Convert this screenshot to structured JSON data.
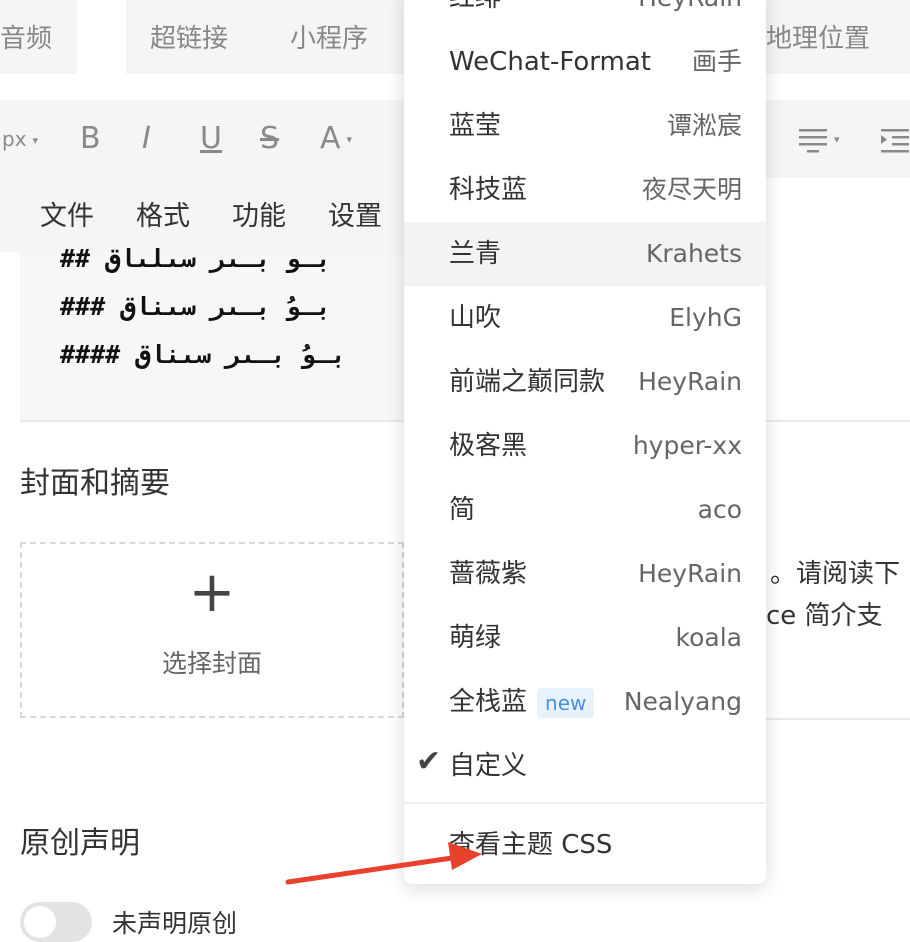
{
  "tabs": {
    "audio": "音频",
    "hyperlink": "超链接",
    "mini_program": "小程序",
    "location": "地理位置"
  },
  "toolbar": {
    "font_size_unit": "px",
    "bold": "B",
    "italic": "I",
    "underline": "U",
    "strikethrough": "S",
    "font_color": "A"
  },
  "menubar": {
    "file": "文件",
    "format": "格式",
    "function": "功能",
    "settings": "设置"
  },
  "editor": {
    "lines": [
      "## بـو بـىر سىلىاق",
      "### بـوُ بـىر سىناق",
      "#### بـوُ بـىر سىناق"
    ]
  },
  "cover": {
    "section_title": "封面和摘要",
    "plus": "+",
    "label": "选择封面"
  },
  "summary": {
    "line1": "。请阅读下",
    "line2": "ce 简介支"
  },
  "original": {
    "section_title": "原创声明",
    "toggle_label": "未声明原创"
  },
  "theme_menu": {
    "partial_top": {
      "name": "红绯",
      "author": "HeyRain"
    },
    "items": [
      {
        "name": "WeChat-Format",
        "author": "画手",
        "active": false
      },
      {
        "name": "蓝莹",
        "author": "谭淞宸",
        "active": false
      },
      {
        "name": "科技蓝",
        "author": "夜尽天明",
        "active": false
      },
      {
        "name": "兰青",
        "author": "Krahets",
        "active": true
      },
      {
        "name": "山吹",
        "author": "ElyhG",
        "active": false
      },
      {
        "name": "前端之巅同款",
        "author": "HeyRain",
        "active": false
      },
      {
        "name": "极客黑",
        "author": "hyper-xx",
        "active": false
      },
      {
        "name": "简",
        "author": "aco",
        "active": false
      },
      {
        "name": "蔷薇紫",
        "author": "HeyRain",
        "active": false
      },
      {
        "name": "萌绿",
        "author": "koala",
        "active": false
      },
      {
        "name": "全栈蓝",
        "author": "Nealyang",
        "badge": "new",
        "active": false
      }
    ],
    "custom": {
      "check": "✔",
      "name": "自定义"
    },
    "view_css": "查看主题 CSS"
  },
  "annotation": {
    "arrow_color": "#e8412c"
  }
}
